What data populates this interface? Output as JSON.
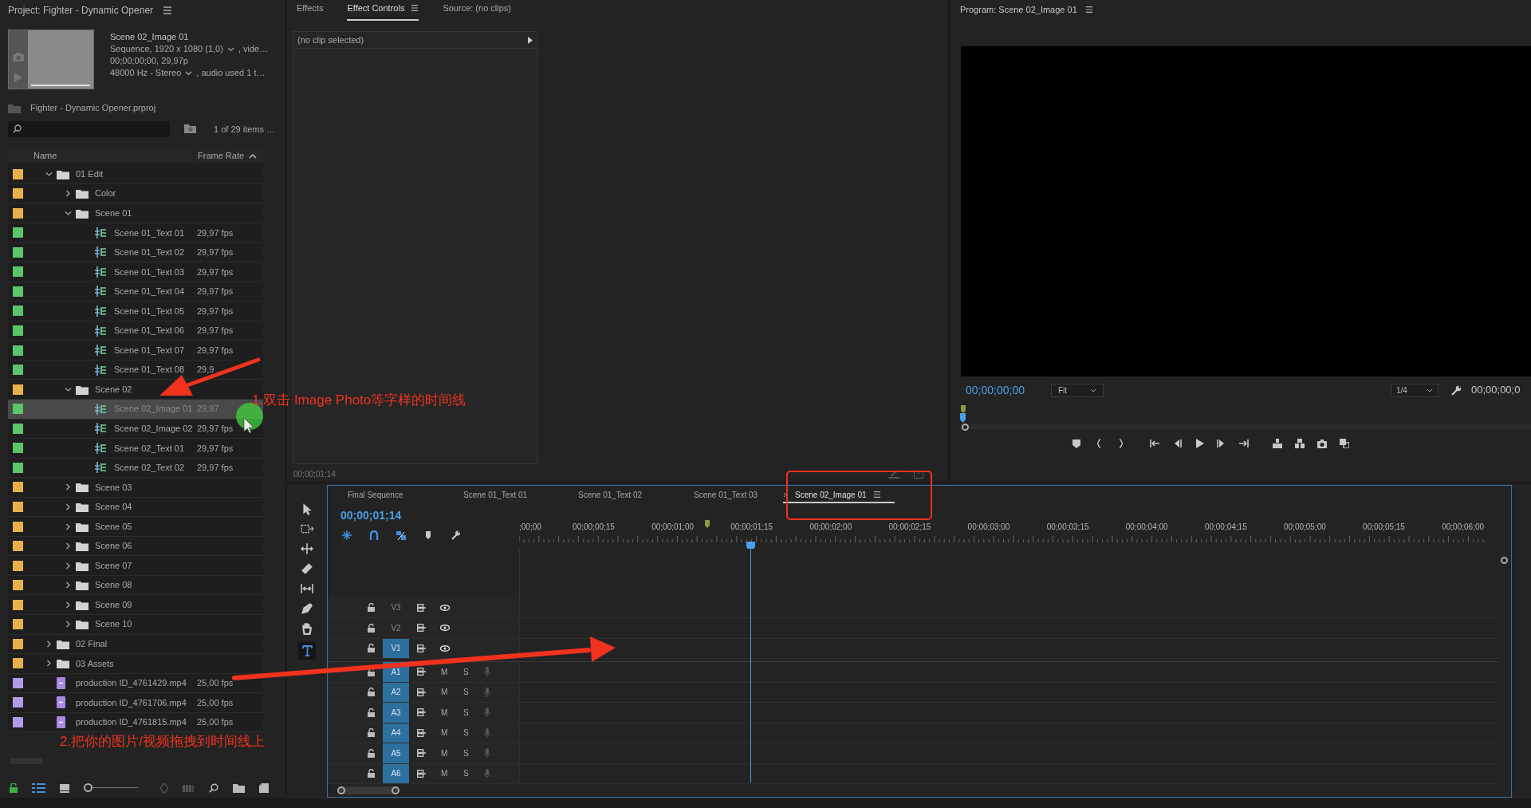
{
  "project": {
    "title": "Project: Fighter - Dynamic Opener",
    "preview": {
      "name": "Scene 02_Image 01",
      "lines": [
        {
          "text": "Sequence, 1920 x 1080 (1,0)",
          "suffix": ", vide…"
        },
        {
          "text": "00;00;00;00, 29,97p"
        },
        {
          "text": "48000 Hz - Stereo",
          "suffix": ", audio used 1 t…"
        }
      ]
    },
    "file": "Fighter - Dynamic Opener.prproj",
    "zoom": {
      "level": 0
    },
    "count": "1 of 29 items …",
    "columns": [
      "Name",
      "Frame Rate"
    ],
    "items": [
      {
        "name": "01 Edit",
        "kind": "folder",
        "color": "#e8b04b",
        "expanded": true,
        "selected": false,
        "children": [
          {
            "name": "Color",
            "kind": "folder",
            "color": "#e8b04b",
            "expanded": false,
            "selected": false
          },
          {
            "name": "Scene 01",
            "kind": "folder",
            "color": "#e8b04b",
            "expanded": true,
            "selected": false,
            "children": [
              {
                "name": "Scene 01_Text 01",
                "rate": "29,97 fps",
                "kind": "sequence",
                "color": "#5cc46a",
                "selected": false
              },
              {
                "name": "Scene 01_Text 02",
                "rate": "29,97 fps",
                "kind": "sequence",
                "color": "#5cc46a",
                "selected": false
              },
              {
                "name": "Scene 01_Text 03",
                "rate": "29,97 fps",
                "kind": "sequence",
                "color": "#5cc46a",
                "selected": false
              },
              {
                "name": "Scene 01_Text 04",
                "rate": "29,97 fps",
                "kind": "sequence",
                "color": "#5cc46a",
                "selected": false
              },
              {
                "name": "Scene 01_Text 05",
                "rate": "29,97 fps",
                "kind": "sequence",
                "color": "#5cc46a",
                "selected": false
              },
              {
                "name": "Scene 01_Text 06",
                "rate": "29,97 fps",
                "kind": "sequence",
                "color": "#5cc46a",
                "selected": false
              },
              {
                "name": "Scene 01_Text 07",
                "rate": "29,97 fps",
                "kind": "sequence",
                "color": "#5cc46a",
                "selected": false
              },
              {
                "name": "Scene 01_Text 08",
                "rate": "29,9",
                "kind": "sequence",
                "color": "#5cc46a",
                "selected": false
              }
            ]
          },
          {
            "name": "Scene 02",
            "kind": "folder",
            "color": "#e8b04b",
            "expanded": true,
            "selected": false,
            "children": [
              {
                "name": "Scene 02_Image 01",
                "rate": "29,97",
                "kind": "sequence",
                "color": "#5cc46a",
                "selected": true
              },
              {
                "name": "Scene 02_Image 02",
                "rate": "29,97 fps",
                "kind": "sequence",
                "color": "#5cc46a",
                "selected": false
              },
              {
                "name": "Scene 02_Text 01",
                "rate": "29,97 fps",
                "kind": "sequence",
                "color": "#5cc46a",
                "selected": false
              },
              {
                "name": "Scene 02_Text 02",
                "rate": "29,97 fps",
                "kind": "sequence",
                "color": "#5cc46a",
                "selected": false
              }
            ]
          },
          {
            "name": "Scene 03",
            "kind": "folder",
            "color": "#e8b04b",
            "expanded": false,
            "selected": false
          },
          {
            "name": "Scene 04",
            "kind": "folder",
            "color": "#e8b04b",
            "expanded": false,
            "selected": false
          },
          {
            "name": "Scene 05",
            "kind": "folder",
            "color": "#e8b04b",
            "expanded": false,
            "selected": false
          },
          {
            "name": "Scene 06",
            "kind": "folder",
            "color": "#e8b04b",
            "expanded": false,
            "selected": false
          },
          {
            "name": "Scene 07",
            "kind": "folder",
            "color": "#e8b04b",
            "expanded": false,
            "selected": false
          },
          {
            "name": "Scene 08",
            "kind": "folder",
            "color": "#e8b04b",
            "expanded": false,
            "selected": false
          },
          {
            "name": "Scene 09",
            "kind": "folder",
            "color": "#e8b04b",
            "expanded": false,
            "selected": false
          },
          {
            "name": "Scene 10",
            "kind": "folder",
            "color": "#e8b04b",
            "expanded": false,
            "selected": false
          }
        ]
      },
      {
        "name": "02 Final",
        "kind": "folder",
        "color": "#e8b04b",
        "expanded": false,
        "selected": false
      },
      {
        "name": "03 Assets",
        "kind": "folder",
        "color": "#e8b04b",
        "expanded": false,
        "selected": false
      },
      {
        "name": "production ID_4761429.mp4",
        "rate": "25,00 fps",
        "kind": "clip",
        "color": "#b39ae6",
        "selected": false
      },
      {
        "name": "production ID_4761706.mp4",
        "rate": "25,00 fps",
        "kind": "clip",
        "color": "#b39ae6",
        "selected": false
      },
      {
        "name": "production ID_4761815.mp4",
        "rate": "25,00 fps",
        "kind": "clip",
        "color": "#b39ae6",
        "selected": false
      }
    ]
  },
  "effects": {
    "tabs": [
      {
        "label": "Effects",
        "selected": false
      },
      {
        "label": "Effect Controls",
        "selected": true
      },
      {
        "label": "Source: (no clips)",
        "selected": false
      }
    ],
    "header": "(no clip selected)",
    "timecode": "00;00;01;14"
  },
  "program": {
    "title": "Program: Scene 02_Image 01",
    "timecode": "00;00;00;00",
    "zoom": "Fit",
    "resolution": "1/4",
    "duration": "00;00;00;0",
    "playhead": {
      "level": 0
    }
  },
  "timeline": {
    "tabs": [
      {
        "label": "Final Sequence",
        "selected": false
      },
      {
        "label": "Scene 01_Text 01",
        "selected": false
      },
      {
        "label": "Scene 01_Text 02",
        "selected": false
      },
      {
        "label": "Scene 01_Text 03",
        "selected": false
      },
      {
        "label": "Scene 02_Image 01",
        "selected": true
      }
    ],
    "timecode": "00;00;01;14",
    "ruler": [
      ";00;00",
      "00;00;00;15",
      "00;00;01;00",
      "00;00;01;15",
      "00;00;02;00",
      "00;00;02;15",
      "00;00;03;00",
      "00;00;03;15",
      "00;00;04;00",
      "00;00;04;15",
      "00;00;05;00",
      "00;00;05;15",
      "00;00;06;00"
    ],
    "playhead": {
      "level": 0.236
    },
    "tracks": [
      {
        "label": "V3",
        "kind": "video",
        "targeted": false
      },
      {
        "label": "V2",
        "kind": "video",
        "targeted": false
      },
      {
        "label": "V1",
        "kind": "video",
        "targeted": true
      },
      {
        "label": "A1",
        "kind": "audio",
        "targeted": true,
        "mute": "M",
        "solo": "S"
      },
      {
        "label": "A2",
        "kind": "audio",
        "targeted": true,
        "mute": "M",
        "solo": "S"
      },
      {
        "label": "A3",
        "kind": "audio",
        "targeted": true,
        "mute": "M",
        "solo": "S"
      },
      {
        "label": "A4",
        "kind": "audio",
        "targeted": true,
        "mute": "M",
        "solo": "S"
      },
      {
        "label": "A5",
        "kind": "audio",
        "targeted": true,
        "mute": "M",
        "solo": "S"
      },
      {
        "label": "A6",
        "kind": "audio",
        "targeted": true,
        "mute": "M",
        "solo": "S"
      }
    ]
  },
  "annotations": [
    "1.双击 Image Photo等字样的时间线",
    "2.把你的图片/视频拖拽到时间线上"
  ]
}
